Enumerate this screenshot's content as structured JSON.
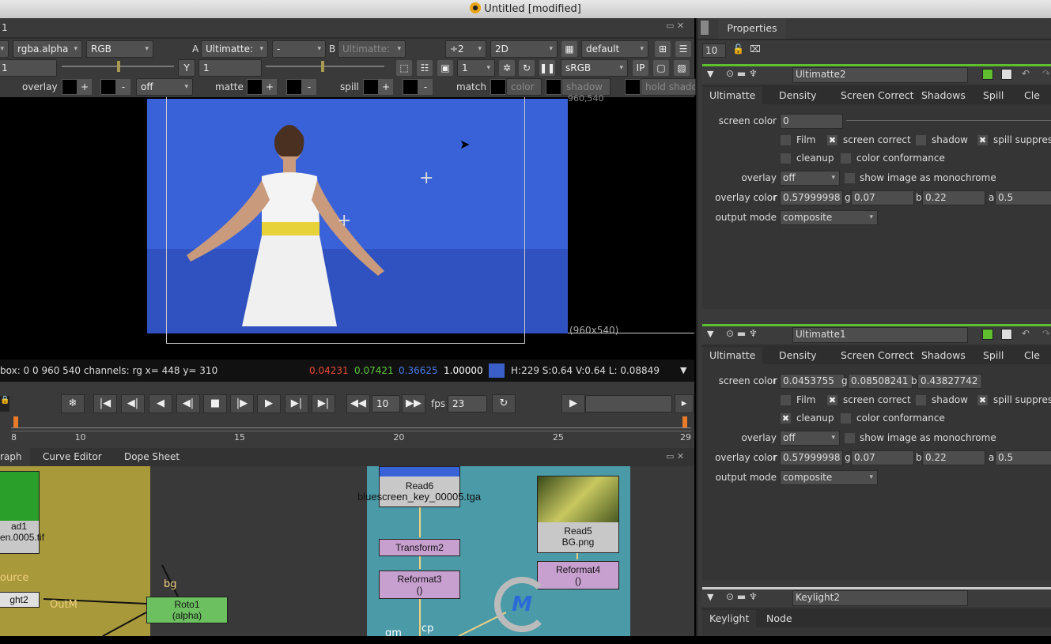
{
  "window": {
    "title": "Untitled [modified]"
  },
  "viewer": {
    "tab": "1",
    "row1": {
      "channels": "rgba.alpha",
      "display": "RGB",
      "a_label": "A",
      "a_input": "Ultimatte:",
      "a_op": "-",
      "b_label": "B",
      "b_input": "Ultimatte:",
      "downscale": "÷2",
      "view_mode": "2D",
      "lut": "default"
    },
    "row2": {
      "gain": "1",
      "gamma_label": "Y",
      "gamma": "1",
      "frame": "1",
      "colorspace": "sRGB",
      "ip": "IP"
    },
    "row3": {
      "overlay": "overlay",
      "overlay_mode": "off",
      "matte": "matte",
      "spill": "spill",
      "match": "match",
      "color": "color",
      "shadow": "shadow",
      "hold": "hold shado",
      "plus": "+",
      "minus": "-"
    },
    "format_label": "960,540",
    "size_label": "(960x540)",
    "info": {
      "left": "box: 0 0 960 540 channels: rg  x= 448 y= 310",
      "r": "0.04231",
      "g": "0.07421",
      "b": "0.36625",
      "a": "1.00000",
      "swatch": "#3a5fc8",
      "hsv": "H:229 S:0.64 V:0.64  L: 0.08849"
    }
  },
  "playback": {
    "increment": "10",
    "fps_label": "fps",
    "fps": "23",
    "timeline": {
      "start": "8",
      "end": "29",
      "ticks": [
        "8",
        "10",
        "15",
        "20",
        "25",
        "29"
      ]
    }
  },
  "nodegraph": {
    "tabs": [
      "raph",
      "Curve Editor",
      "Dope Sheet"
    ],
    "nodes": {
      "read1": "ad1",
      "read1_file": "en.0005.tif",
      "source": "ource",
      "keylight": "ght2",
      "outm": "OutM",
      "bg": "bg",
      "roto": "Roto1",
      "roto_sub": "(alpha)",
      "read6": "Read6",
      "read6_file": "bluescreen_key_00005.tga",
      "transform": "Transform2",
      "reformat3": "Reformat3",
      "reformat3_sub": "()",
      "read5": "Read5",
      "read5_file": "BG.png",
      "reformat4": "Reformat4",
      "reformat4_sub": "()",
      "cp": "cp",
      "gm": "gm"
    }
  },
  "properties": {
    "tab": "Properties",
    "max_panels": "10",
    "panels": [
      {
        "name": "Ultimatte2",
        "tabs": [
          "Ultimatte",
          "Density",
          "Screen Correct",
          "Shadows",
          "Spill",
          "Cle"
        ],
        "screen_color_label": "screen color",
        "screen_color": [
          "0"
        ],
        "checks": [
          {
            "label": "Film",
            "on": false
          },
          {
            "label": "screen correct",
            "on": true
          },
          {
            "label": "shadow",
            "on": false
          },
          {
            "label": "spill suppress",
            "on": true
          },
          {
            "label": "cleanup",
            "on": false
          },
          {
            "label": "color conformance",
            "on": false
          }
        ],
        "overlay_label": "overlay",
        "overlay": "off",
        "mono_label": "show image as monochrome",
        "overlay_color_label": "overlay color",
        "overlay_color": {
          "r": "0.57999998",
          "g": "0.07",
          "b": "0.22",
          "a": "0.5"
        },
        "output_label": "output mode",
        "output": "composite"
      },
      {
        "name": "Ultimatte1",
        "tabs": [
          "Ultimatte",
          "Density",
          "Screen Correct",
          "Shadows",
          "Spill",
          "Cle"
        ],
        "screen_color_label": "screen color",
        "screen_color": [
          "0.0453755",
          "0.08508241",
          "0.43827742"
        ],
        "checks": [
          {
            "label": "Film",
            "on": false
          },
          {
            "label": "screen correct",
            "on": true
          },
          {
            "label": "shadow",
            "on": false
          },
          {
            "label": "spill suppress",
            "on": true
          },
          {
            "label": "cleanup",
            "on": true
          },
          {
            "label": "color conformance",
            "on": false
          }
        ],
        "overlay_label": "overlay",
        "overlay": "off",
        "mono_label": "show image as monochrome",
        "overlay_color_label": "overlay color",
        "overlay_color": {
          "r": "0.57999998",
          "g": "0.07",
          "b": "0.22",
          "a": "0.5"
        },
        "output_label": "output mode",
        "output": "composite"
      }
    ],
    "keylight": {
      "name": "Keylight2",
      "tabs": [
        "Keylight",
        "Node"
      ]
    }
  },
  "colors": {
    "accent_green": "#5fbf2f",
    "bluescreen": "#3a62d8",
    "backdrop_yellow": "#a89a3a",
    "backdrop_teal": "#4a9aa8"
  }
}
